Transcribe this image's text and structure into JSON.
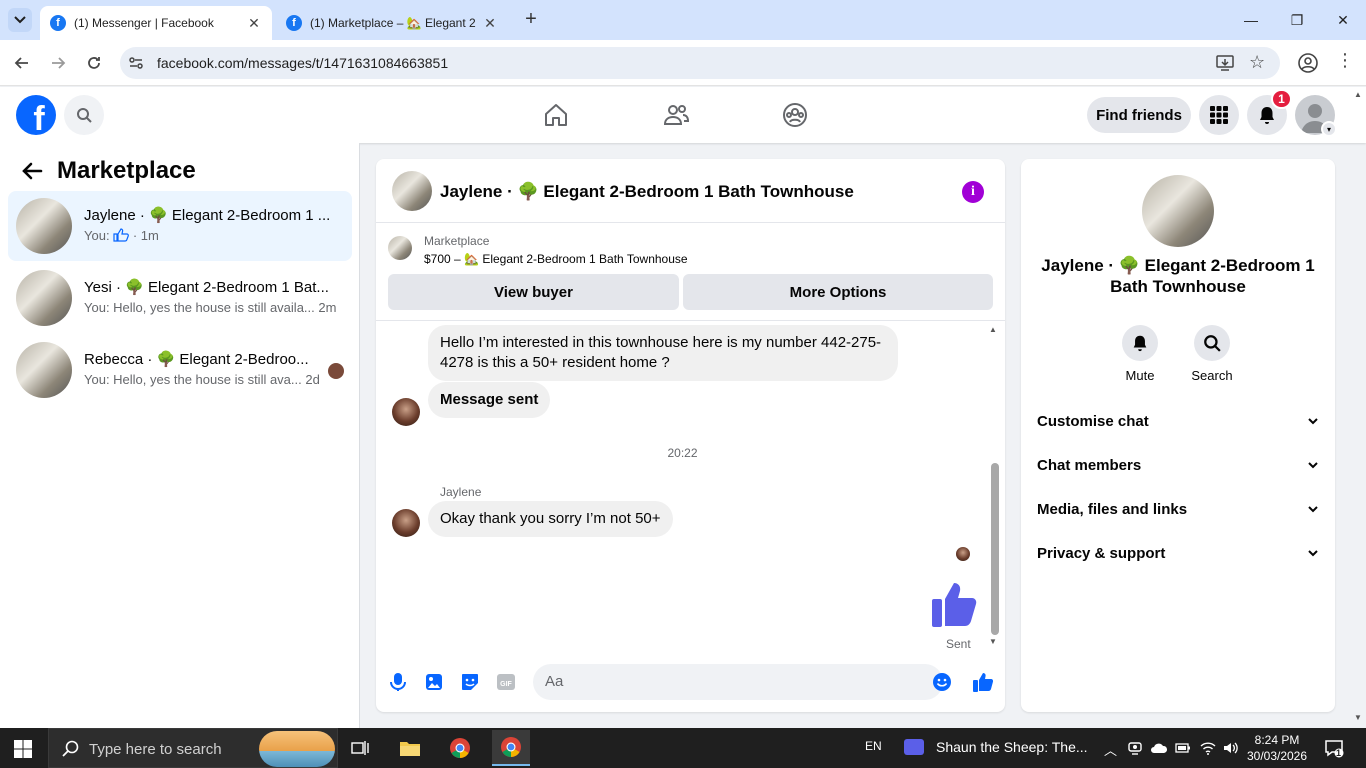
{
  "browser": {
    "tabs": [
      {
        "title": "(1) Messenger | Facebook",
        "active": true
      },
      {
        "title": "(1) Marketplace – 🏡 Elegant 2",
        "active": false
      }
    ],
    "url": "facebook.com/messages/t/1471631084663851"
  },
  "fb": {
    "find_friends": "Find friends",
    "notification_count": "1",
    "brand_color": "#0866ff"
  },
  "left": {
    "title": "Marketplace",
    "conversations": [
      {
        "name": "Jaylene · 🌳 Elegant 2-Bedroom 1 ...",
        "preview_prefix": "You:",
        "preview_suffix": "· 1m"
      },
      {
        "name": "Yesi · 🌳 Elegant 2-Bedroom 1 Bat...",
        "preview": "You: Hello, yes the house is still availa...",
        "time": "2m"
      },
      {
        "name": "Rebecca · 🌳 Elegant 2-Bedroo...",
        "preview": "You: Hello, yes the house is still ava...",
        "time": "2d"
      }
    ]
  },
  "chat": {
    "title": "Jaylene · 🌳 Elegant 2-Bedroom 1 Bath Townhouse",
    "marketplace_label": "Marketplace",
    "listing": "$700 – 🏡 Elegant 2-Bedroom 1 Bath Townhouse",
    "view_buyer": "View buyer",
    "more_options": "More Options",
    "messages": [
      {
        "text": "Hello I’m interested in this townhouse here is my number 442-275-4278 is this a 50+ resident home ?"
      },
      {
        "text": "Message sent"
      },
      {
        "text": "Okay thank you sorry I’m not 50+"
      }
    ],
    "timestamp": "20:22",
    "sender": "Jaylene",
    "sent_status": "Sent",
    "composer_placeholder": "Aa"
  },
  "right": {
    "title": "Jaylene · 🌳 Elegant 2-Bedroom 1 Bath Townhouse",
    "mute": "Mute",
    "search": "Search",
    "rows": [
      "Customise chat",
      "Chat members",
      "Media, files and links",
      "Privacy & support"
    ]
  },
  "taskbar": {
    "search_placeholder": "Type here to search",
    "lang": "EN",
    "media": "Shaun the Sheep: The...",
    "time": "8:24 PM",
    "date": "30/03/2026",
    "notif_count": "1"
  }
}
